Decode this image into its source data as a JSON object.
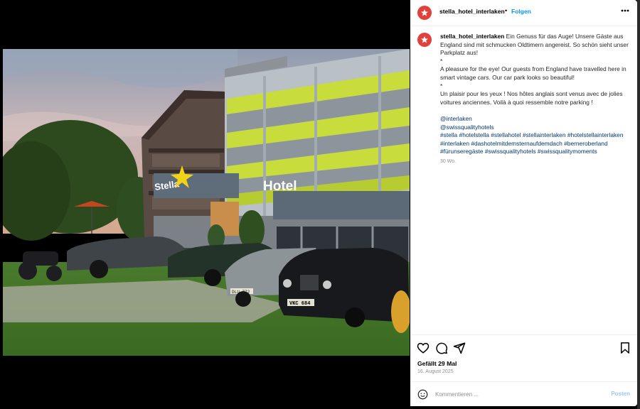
{
  "post": {
    "username": "stella_hotel_interlaken",
    "separator": "•",
    "follow_label": "Folgen",
    "caption": {
      "german": "Ein Genuss für das Auge! Unsere Gäste aus England sind mit schmucken Oldtimern angereist. So schön sieht unser Parkplatz aus!",
      "star1": "*",
      "english": "A pleasure for the eye! Our guests from England have travelled here in smart vintage cars. Our car park looks so beautiful!",
      "star2": "*",
      "french": "Un plaisir pour les yeux ! Nos hôtes anglais sont venus avec de jolies voitures anciennes. Voilà à quoi ressemble notre parking !"
    },
    "mentions": [
      "@interlaken",
      "@swissqualityhotels"
    ],
    "hashtags": [
      "#stella",
      "#hotelstella",
      "#stellahotel",
      "#stellainterlaken",
      "#hotelstellainterlaken",
      "#interlaken",
      "#dashotelmitdemsternaufdemdach",
      "#berneroberland",
      "#fürunseregäste",
      "#swissqualityhotels",
      "#swissqualitymoments"
    ],
    "caption_time": "30 Wo.",
    "likes_text": "Gefällt 29 Mal",
    "date": "16. August 2025"
  },
  "photo": {
    "sign_hotel": "Hotel",
    "sign_stella": "Stella",
    "plate_front": "VKC 684",
    "plate_mid": "DLU 772",
    "accent_green": "#c8dc3c",
    "sky_color": "#c9b7b9"
  },
  "comment": {
    "placeholder": "Kommentieren ...",
    "post_label": "Posten"
  },
  "icons": {
    "more": "more-icon",
    "like": "heart-icon",
    "comment": "comment-icon",
    "share": "share-icon",
    "save": "bookmark-icon",
    "emoji": "emoji-icon"
  }
}
